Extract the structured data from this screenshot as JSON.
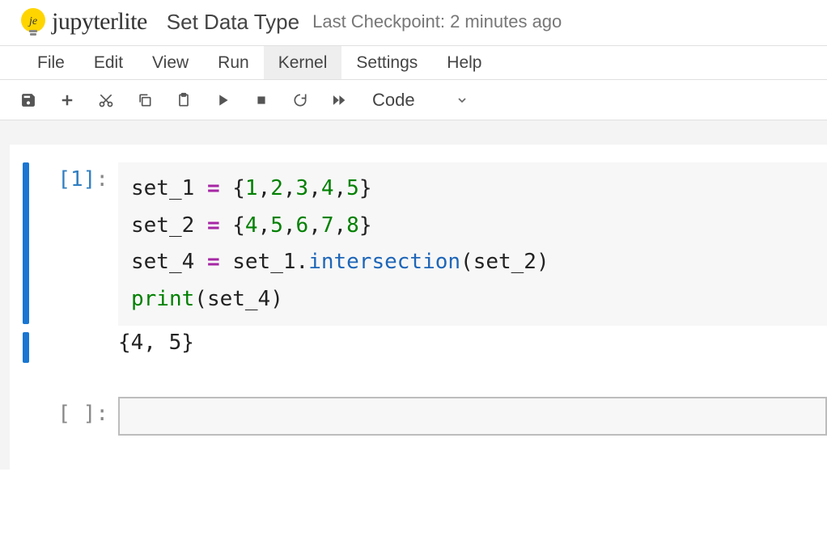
{
  "header": {
    "brand": "jupyterlite",
    "title": "Set Data Type",
    "checkpoint": "Last Checkpoint: 2 minutes ago"
  },
  "menu": {
    "items": [
      "File",
      "Edit",
      "View",
      "Run",
      "Kernel",
      "Settings",
      "Help"
    ],
    "active_index": 4
  },
  "toolbar": {
    "cell_type": "Code"
  },
  "cells": [
    {
      "execution_count": 1,
      "prompt": "[1]:",
      "code_lines": [
        {
          "tokens": [
            [
              "var",
              "set_1"
            ],
            [
              "sp",
              " "
            ],
            [
              "op",
              "="
            ],
            [
              "sp",
              " "
            ],
            [
              "brace",
              "{"
            ],
            [
              "num",
              "1"
            ],
            [
              "brace",
              ","
            ],
            [
              "num",
              "2"
            ],
            [
              "brace",
              ","
            ],
            [
              "num",
              "3"
            ],
            [
              "brace",
              ","
            ],
            [
              "num",
              "4"
            ],
            [
              "brace",
              ","
            ],
            [
              "num",
              "5"
            ],
            [
              "brace",
              "}"
            ]
          ]
        },
        {
          "tokens": [
            [
              "var",
              "set_2"
            ],
            [
              "sp",
              " "
            ],
            [
              "op",
              "="
            ],
            [
              "sp",
              " "
            ],
            [
              "brace",
              "{"
            ],
            [
              "num",
              "4"
            ],
            [
              "brace",
              ","
            ],
            [
              "num",
              "5"
            ],
            [
              "brace",
              ","
            ],
            [
              "num",
              "6"
            ],
            [
              "brace",
              ","
            ],
            [
              "num",
              "7"
            ],
            [
              "brace",
              ","
            ],
            [
              "num",
              "8"
            ],
            [
              "brace",
              "}"
            ]
          ]
        },
        {
          "tokens": [
            [
              "var",
              "set_4"
            ],
            [
              "sp",
              " "
            ],
            [
              "op",
              "="
            ],
            [
              "sp",
              " "
            ],
            [
              "var",
              "set_1"
            ],
            [
              "brace",
              "."
            ],
            [
              "method",
              "intersection"
            ],
            [
              "brace",
              "("
            ],
            [
              "var",
              "set_2"
            ],
            [
              "brace",
              ")"
            ]
          ]
        },
        {
          "tokens": [
            [
              "builtin",
              "print"
            ],
            [
              "brace",
              "("
            ],
            [
              "var",
              "set_4"
            ],
            [
              "brace",
              ")"
            ]
          ]
        }
      ],
      "output": "{4, 5}"
    },
    {
      "execution_count": null,
      "prompt": "[ ]:",
      "code_lines": [],
      "output": null
    }
  ]
}
